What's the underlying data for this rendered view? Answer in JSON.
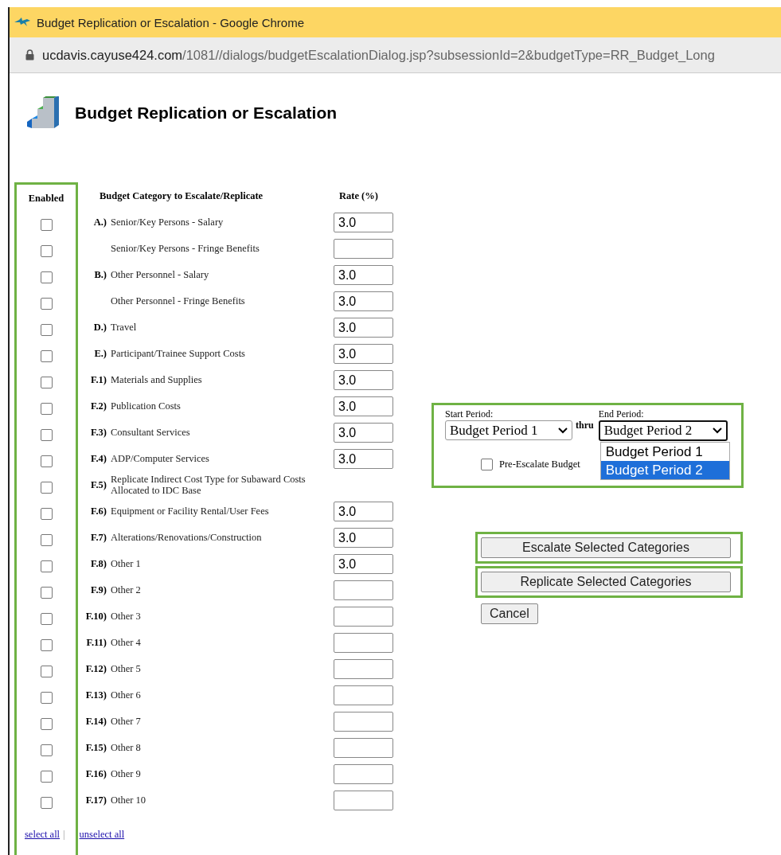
{
  "browser": {
    "title": "Budget Replication or Escalation - Google Chrome",
    "url_host": "ucdavis.cayuse424.com",
    "url_path": "/1081//dialogs/budgetEscalationDialog.jsp?subsessionId=2&budgetType=RR_Budget_Long"
  },
  "heading": "Budget Replication or Escalation",
  "columns": {
    "enabled": "Enabled",
    "category": "Budget Category to Escalate/Replicate",
    "rate": "Rate  (%)"
  },
  "rows": [
    {
      "code": "A.)",
      "label": "Senior/Key Persons - Salary",
      "checked": false,
      "rate_field": true,
      "rate": "3.0"
    },
    {
      "label": "Senior/Key Persons - Fringe Benefits",
      "checked": false,
      "rate_field": true
    },
    {
      "code": "B.)",
      "label": "Other Personnel - Salary",
      "checked": false,
      "rate_field": true,
      "rate": "3.0"
    },
    {
      "label": "Other Personnel - Fringe Benefits",
      "checked": false,
      "rate_field": true,
      "rate": "3.0"
    },
    {
      "code": "D.)",
      "label": "Travel",
      "checked": false,
      "rate_field": true,
      "rate": "3.0"
    },
    {
      "code": "E.)",
      "label": "Participant/Trainee Support Costs",
      "checked": false,
      "rate_field": true,
      "rate": "3.0"
    },
    {
      "code": "F.1)",
      "label": "Materials and Supplies",
      "checked": false,
      "rate_field": true,
      "rate": "3.0"
    },
    {
      "code": "F.2)",
      "label": "Publication Costs",
      "checked": false,
      "rate_field": true,
      "rate": "3.0"
    },
    {
      "code": "F.3)",
      "label": "Consultant Services",
      "checked": false,
      "rate_field": true,
      "rate": "3.0"
    },
    {
      "code": "F.4)",
      "label": "ADP/Computer Services",
      "checked": false,
      "rate_field": true,
      "rate": "3.0"
    },
    {
      "code": "F.5)",
      "label": "Replicate Indirect Cost Type for Subaward Costs Allocated to IDC Base",
      "checked": false,
      "rate_field": false
    },
    {
      "code": "F.6)",
      "label": "Equipment or Facility Rental/User Fees",
      "checked": false,
      "rate_field": true,
      "rate": "3.0"
    },
    {
      "code": "F.7)",
      "label": "Alterations/Renovations/Construction",
      "checked": false,
      "rate_field": true,
      "rate": "3.0"
    },
    {
      "code": "F.8)",
      "label": "Other 1",
      "checked": false,
      "rate_field": true,
      "rate": "3.0"
    },
    {
      "code": "F.9)",
      "label": "Other 2",
      "checked": false,
      "rate_field": true
    },
    {
      "code": "F.10)",
      "label": "Other 3",
      "checked": false,
      "rate_field": true
    },
    {
      "code": "F.11)",
      "label": "Other 4",
      "checked": false,
      "rate_field": true
    },
    {
      "code": "F.12)",
      "label": "Other 5",
      "checked": false,
      "rate_field": true
    },
    {
      "code": "F.13)",
      "label": "Other 6",
      "checked": false,
      "rate_field": true
    },
    {
      "code": "F.14)",
      "label": "Other 7",
      "checked": false,
      "rate_field": true
    },
    {
      "code": "F.15)",
      "label": "Other 8",
      "checked": false,
      "rate_field": true
    },
    {
      "code": "F.16)",
      "label": "Other 9",
      "checked": false,
      "rate_field": true
    },
    {
      "code": "F.17)",
      "label": "Other 10",
      "checked": false,
      "rate_field": true
    }
  ],
  "links": {
    "select_all": "select all",
    "separator": "|",
    "unselect_all": "unselect all"
  },
  "period": {
    "start_label": "Start Period:",
    "start_value": "Budget Period 1",
    "thru": "thru",
    "end_label": "End Period:",
    "end_value": "Budget Period 2",
    "expanded": true,
    "options": [
      {
        "label": "Budget Period 1",
        "selected": false
      },
      {
        "label": "Budget Period 2",
        "selected": true
      }
    ]
  },
  "pre_escalate": {
    "label": "Pre-Escalate Budget",
    "checked": false
  },
  "buttons": [
    {
      "label": "Escalate Selected Categories",
      "highlighted": true,
      "kind": "wide"
    },
    {
      "label": "Replicate Selected Categories",
      "highlighted": true,
      "kind": "wide"
    },
    {
      "label": "Cancel",
      "highlighted": false,
      "kind": "small"
    }
  ]
}
